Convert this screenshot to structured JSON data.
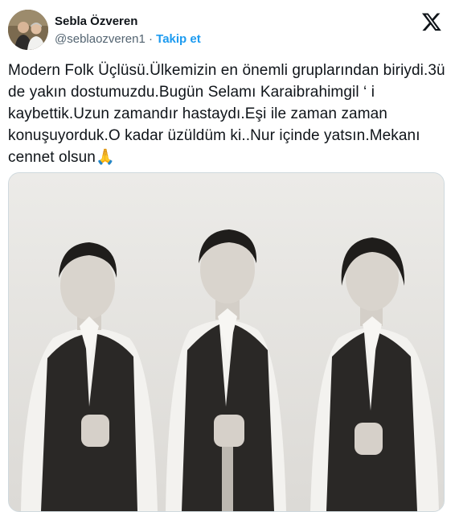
{
  "author": {
    "display_name": "Sebla Özveren",
    "handle": "@seblaozveren1",
    "separator": " · ",
    "follow_label": "Takip et"
  },
  "tweet": {
    "text": "Modern Folk Üçlüsü.Ülkemizin en önemli gruplarından biriydi.3ü de yakın dostumuzdu.Bugün Selamı Karaibrahimgil ‘ i kaybettik.Uzun zamandır hastaydı.Eşi ile zaman zaman konuşuyorduk.O kadar üzüldüm ki..Nur içinde yatsın.Mekanı cennet olsun",
    "emoji": "🙏"
  },
  "icons": {
    "platform": "x-logo-icon"
  },
  "colors": {
    "link": "#1d9bf0",
    "text": "#0f1419",
    "secondary": "#536471",
    "border": "#cfd9de"
  }
}
